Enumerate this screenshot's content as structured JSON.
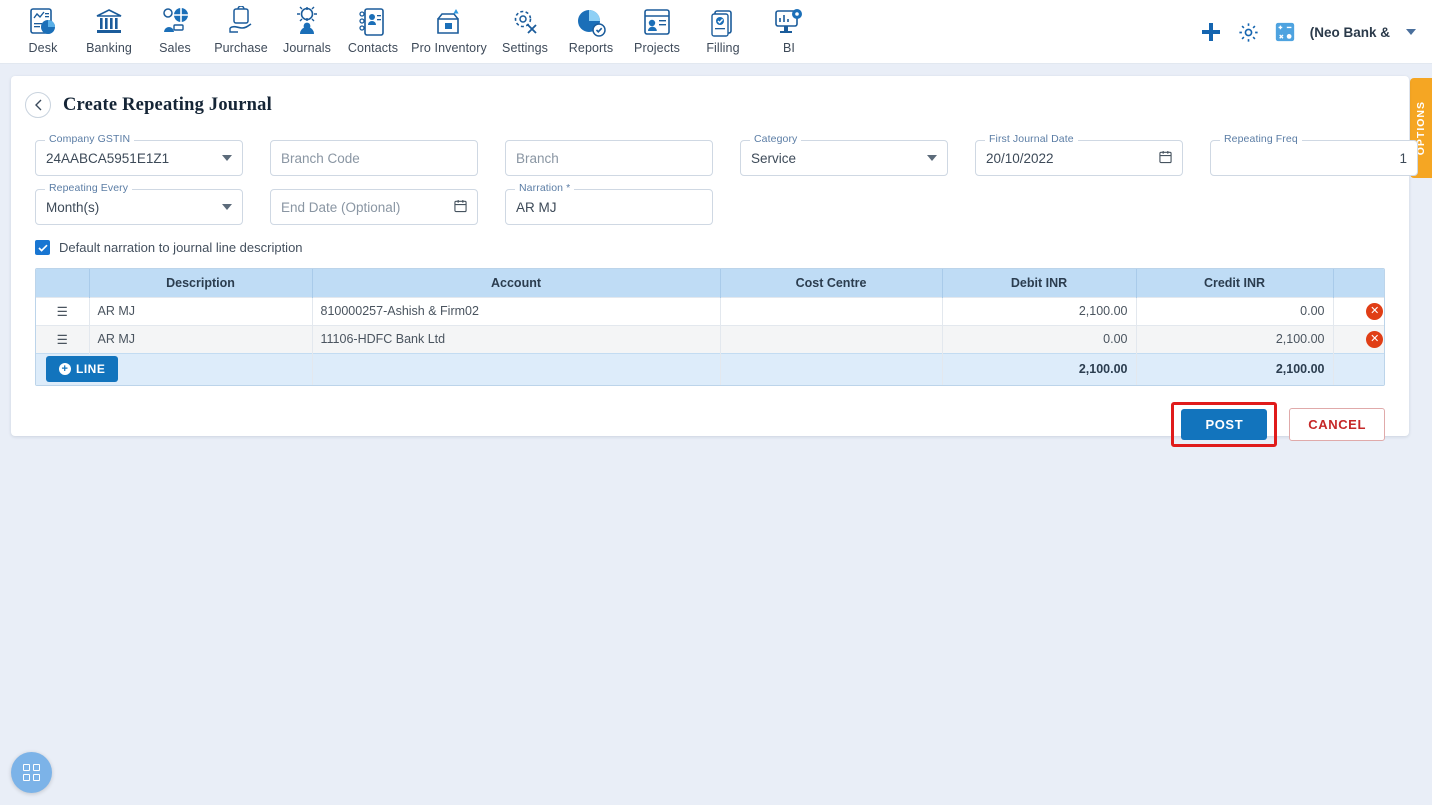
{
  "nav": {
    "items": [
      {
        "label": "Desk",
        "icon": "dashboard-icon"
      },
      {
        "label": "Banking",
        "icon": "bank-icon"
      },
      {
        "label": "Sales",
        "icon": "sales-icon"
      },
      {
        "label": "Purchase",
        "icon": "purchase-icon"
      },
      {
        "label": "Journals",
        "icon": "journals-icon"
      },
      {
        "label": "Contacts",
        "icon": "contacts-icon"
      },
      {
        "label": "Pro Inventory",
        "icon": "inventory-icon"
      },
      {
        "label": "Settings",
        "icon": "settings-icon"
      },
      {
        "label": "Reports",
        "icon": "reports-icon"
      },
      {
        "label": "Projects",
        "icon": "projects-icon"
      },
      {
        "label": "Filling",
        "icon": "filling-icon"
      },
      {
        "label": "BI",
        "icon": "bi-icon"
      }
    ],
    "right": {
      "add_icon": "plus-icon",
      "settings_icon": "gear-icon",
      "calculator_icon": "calculator-icon",
      "org_name": "(Neo Bank &",
      "dropdown_icon": "chevron-down-icon"
    }
  },
  "page": {
    "back_icon": "chevron-left-icon",
    "title": "Create Repeating Journal"
  },
  "options_tab": {
    "label": "OPTIONS"
  },
  "form": {
    "company_gstin": {
      "label": "Company GSTIN",
      "value": "24AABCA5951E1Z1"
    },
    "branch_code": {
      "label": "",
      "placeholder": "Branch Code"
    },
    "branch": {
      "label": "",
      "placeholder": "Branch"
    },
    "category": {
      "label": "Category",
      "value": "Service"
    },
    "first_journal_date": {
      "label": "First Journal Date",
      "value": "20/10/2022"
    },
    "repeating_freq": {
      "label": "Repeating Freq",
      "value": "1"
    },
    "repeating_every": {
      "label": "Repeating Every",
      "value": "Month(s)"
    },
    "end_date": {
      "label": "",
      "placeholder": "End Date (Optional)"
    },
    "narration": {
      "label": "Narration *",
      "value": "AR MJ"
    }
  },
  "checkbox": {
    "label": "Default narration to journal line description",
    "checked": true
  },
  "table": {
    "columns": [
      "",
      "Description",
      "Account",
      "Cost Centre",
      "Debit INR",
      "Credit INR",
      ""
    ],
    "rows": [
      {
        "handle": "drag-handle-icon",
        "description": "AR MJ",
        "account": "810000257-Ashish & Firm02",
        "cost_centre": "",
        "debit": "2,100.00",
        "credit": "0.00",
        "delete_icon": "delete-icon"
      },
      {
        "handle": "drag-handle-icon",
        "description": "AR MJ",
        "account": "11106-HDFC Bank Ltd",
        "cost_centre": "",
        "debit": "0.00",
        "credit": "2,100.00",
        "delete_icon": "delete-icon"
      }
    ],
    "add_line_label": "LINE",
    "totals": {
      "debit": "2,100.00",
      "credit": "2,100.00"
    }
  },
  "actions": {
    "post_label": "POST",
    "cancel_label": "CANCEL",
    "highlight_color": "#e01b1b"
  },
  "fab": {
    "icon": "apps-grid-icon"
  }
}
